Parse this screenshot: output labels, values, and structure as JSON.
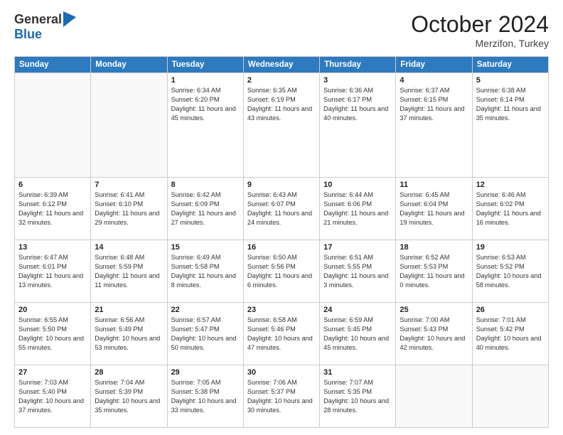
{
  "header": {
    "logo_line1": "General",
    "logo_line2": "Blue",
    "month": "October 2024",
    "location": "Merzifon, Turkey"
  },
  "days_of_week": [
    "Sunday",
    "Monday",
    "Tuesday",
    "Wednesday",
    "Thursday",
    "Friday",
    "Saturday"
  ],
  "weeks": [
    [
      {
        "day": "",
        "info": ""
      },
      {
        "day": "",
        "info": ""
      },
      {
        "day": "1",
        "info": "Sunrise: 6:34 AM\nSunset: 6:20 PM\nDaylight: 11 hours and 45 minutes."
      },
      {
        "day": "2",
        "info": "Sunrise: 6:35 AM\nSunset: 6:19 PM\nDaylight: 11 hours and 43 minutes."
      },
      {
        "day": "3",
        "info": "Sunrise: 6:36 AM\nSunset: 6:17 PM\nDaylight: 11 hours and 40 minutes."
      },
      {
        "day": "4",
        "info": "Sunrise: 6:37 AM\nSunset: 6:15 PM\nDaylight: 11 hours and 37 minutes."
      },
      {
        "day": "5",
        "info": "Sunrise: 6:38 AM\nSunset: 6:14 PM\nDaylight: 11 hours and 35 minutes."
      }
    ],
    [
      {
        "day": "6",
        "info": "Sunrise: 6:39 AM\nSunset: 6:12 PM\nDaylight: 11 hours and 32 minutes."
      },
      {
        "day": "7",
        "info": "Sunrise: 6:41 AM\nSunset: 6:10 PM\nDaylight: 11 hours and 29 minutes."
      },
      {
        "day": "8",
        "info": "Sunrise: 6:42 AM\nSunset: 6:09 PM\nDaylight: 11 hours and 27 minutes."
      },
      {
        "day": "9",
        "info": "Sunrise: 6:43 AM\nSunset: 6:07 PM\nDaylight: 11 hours and 24 minutes."
      },
      {
        "day": "10",
        "info": "Sunrise: 6:44 AM\nSunset: 6:06 PM\nDaylight: 11 hours and 21 minutes."
      },
      {
        "day": "11",
        "info": "Sunrise: 6:45 AM\nSunset: 6:04 PM\nDaylight: 11 hours and 19 minutes."
      },
      {
        "day": "12",
        "info": "Sunrise: 6:46 AM\nSunset: 6:02 PM\nDaylight: 11 hours and 16 minutes."
      }
    ],
    [
      {
        "day": "13",
        "info": "Sunrise: 6:47 AM\nSunset: 6:01 PM\nDaylight: 11 hours and 13 minutes."
      },
      {
        "day": "14",
        "info": "Sunrise: 6:48 AM\nSunset: 5:59 PM\nDaylight: 11 hours and 11 minutes."
      },
      {
        "day": "15",
        "info": "Sunrise: 6:49 AM\nSunset: 5:58 PM\nDaylight: 11 hours and 8 minutes."
      },
      {
        "day": "16",
        "info": "Sunrise: 6:50 AM\nSunset: 5:56 PM\nDaylight: 11 hours and 6 minutes."
      },
      {
        "day": "17",
        "info": "Sunrise: 6:51 AM\nSunset: 5:55 PM\nDaylight: 11 hours and 3 minutes."
      },
      {
        "day": "18",
        "info": "Sunrise: 6:52 AM\nSunset: 5:53 PM\nDaylight: 11 hours and 0 minutes."
      },
      {
        "day": "19",
        "info": "Sunrise: 6:53 AM\nSunset: 5:52 PM\nDaylight: 10 hours and 58 minutes."
      }
    ],
    [
      {
        "day": "20",
        "info": "Sunrise: 6:55 AM\nSunset: 5:50 PM\nDaylight: 10 hours and 55 minutes."
      },
      {
        "day": "21",
        "info": "Sunrise: 6:56 AM\nSunset: 5:49 PM\nDaylight: 10 hours and 53 minutes."
      },
      {
        "day": "22",
        "info": "Sunrise: 6:57 AM\nSunset: 5:47 PM\nDaylight: 10 hours and 50 minutes."
      },
      {
        "day": "23",
        "info": "Sunrise: 6:58 AM\nSunset: 5:46 PM\nDaylight: 10 hours and 47 minutes."
      },
      {
        "day": "24",
        "info": "Sunrise: 6:59 AM\nSunset: 5:45 PM\nDaylight: 10 hours and 45 minutes."
      },
      {
        "day": "25",
        "info": "Sunrise: 7:00 AM\nSunset: 5:43 PM\nDaylight: 10 hours and 42 minutes."
      },
      {
        "day": "26",
        "info": "Sunrise: 7:01 AM\nSunset: 5:42 PM\nDaylight: 10 hours and 40 minutes."
      }
    ],
    [
      {
        "day": "27",
        "info": "Sunrise: 7:03 AM\nSunset: 5:40 PM\nDaylight: 10 hours and 37 minutes."
      },
      {
        "day": "28",
        "info": "Sunrise: 7:04 AM\nSunset: 5:39 PM\nDaylight: 10 hours and 35 minutes."
      },
      {
        "day": "29",
        "info": "Sunrise: 7:05 AM\nSunset: 5:38 PM\nDaylight: 10 hours and 33 minutes."
      },
      {
        "day": "30",
        "info": "Sunrise: 7:06 AM\nSunset: 5:37 PM\nDaylight: 10 hours and 30 minutes."
      },
      {
        "day": "31",
        "info": "Sunrise: 7:07 AM\nSunset: 5:35 PM\nDaylight: 10 hours and 28 minutes."
      },
      {
        "day": "",
        "info": ""
      },
      {
        "day": "",
        "info": ""
      }
    ]
  ]
}
